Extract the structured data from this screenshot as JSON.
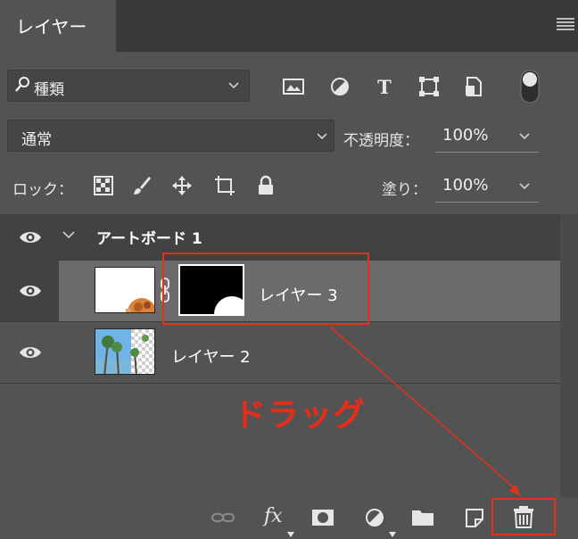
{
  "panel": {
    "tab_label": "レイヤー",
    "menu_icon": "panel-menu-icon"
  },
  "filter": {
    "kind_label": "種類",
    "search_icon": "search-icon",
    "icons": [
      "image-filter-icon",
      "adjustment-filter-icon",
      "type-filter-icon",
      "shape-filter-icon",
      "smart-object-filter-icon",
      "filter-toggle-icon"
    ]
  },
  "blend": {
    "mode": "通常",
    "opacity_label": "不透明度：",
    "opacity_value": "100%"
  },
  "lock": {
    "label": "ロック：",
    "icons": [
      "lock-transparent-pixels-icon",
      "lock-image-pixels-icon",
      "lock-position-icon",
      "lock-artboard-icon",
      "lock-all-icon"
    ],
    "fill_label": "塗り：",
    "fill_value": "100%"
  },
  "layers": [
    {
      "name": "アートボード 1",
      "type": "artboard",
      "visible": true,
      "expanded": true
    },
    {
      "name": "レイヤー 3",
      "type": "layer-with-mask",
      "visible": true,
      "selected": true
    },
    {
      "name": "レイヤー 2",
      "type": "layer",
      "visible": true
    }
  ],
  "annotation": {
    "drag_text": "ドラッグ",
    "color": "#e5311b"
  },
  "bottom_bar": {
    "fx_label": "fx",
    "icons": [
      "link-layers-icon",
      "fx-icon",
      "add-mask-icon",
      "new-adjustment-icon",
      "new-group-icon",
      "new-layer-icon",
      "trash-icon"
    ]
  },
  "colors": {
    "panel_bg": "#535353",
    "tab_bar_bg": "#393939",
    "selected_row": "#6b6b6b",
    "annotation_red": "#e5311b"
  }
}
